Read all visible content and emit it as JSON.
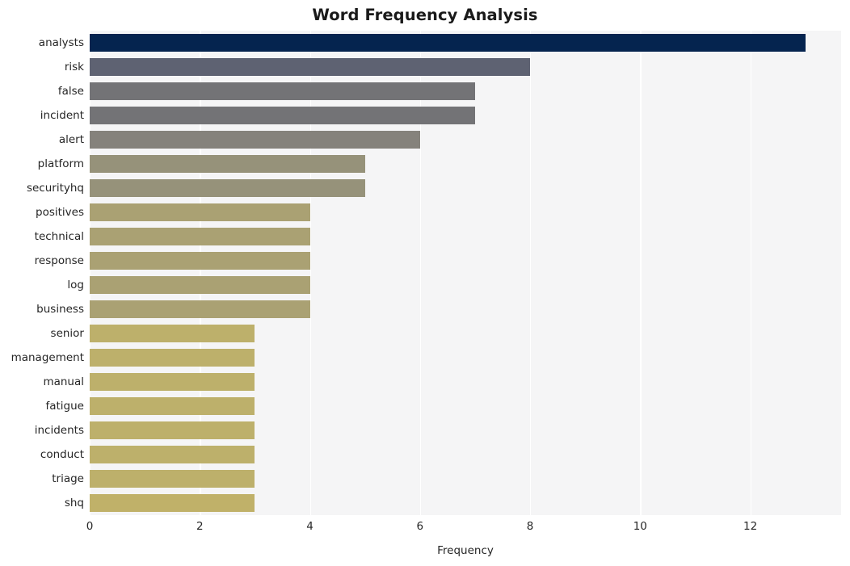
{
  "chart_data": {
    "type": "bar",
    "orientation": "horizontal",
    "title": "Word Frequency Analysis",
    "xlabel": "Frequency",
    "ylabel": "",
    "categories": [
      "analysts",
      "risk",
      "false",
      "incident",
      "alert",
      "platform",
      "securityhq",
      "positives",
      "technical",
      "response",
      "log",
      "business",
      "senior",
      "management",
      "manual",
      "fatigue",
      "incidents",
      "conduct",
      "triage",
      "shq"
    ],
    "values": [
      13,
      8,
      7,
      7,
      6,
      5,
      5,
      4,
      4,
      4,
      4,
      4,
      3,
      3,
      3,
      3,
      3,
      3,
      3,
      3
    ],
    "bar_colors": [
      "#05244f",
      "#5e6272",
      "#737376",
      "#737376",
      "#85827c",
      "#96927a",
      "#96927a",
      "#aaa173",
      "#aaa173",
      "#aaa173",
      "#aaa173",
      "#aaa173",
      "#bdb06b",
      "#bdb06b",
      "#bdb06b",
      "#bdb06b",
      "#bdb06b",
      "#bdb06b",
      "#bdb06b",
      "#c0b169"
    ],
    "xticks": [
      0,
      2,
      4,
      6,
      8,
      10,
      12
    ],
    "xtick_labels": [
      "0",
      "2",
      "4",
      "6",
      "8",
      "10",
      "12"
    ],
    "xlim": [
      0,
      13.65
    ],
    "grid": true,
    "grid_axis": "x",
    "grid_color": "#ffffff",
    "plot_background": "#f5f5f6",
    "figure_background": "#ffffff",
    "legend": null
  }
}
